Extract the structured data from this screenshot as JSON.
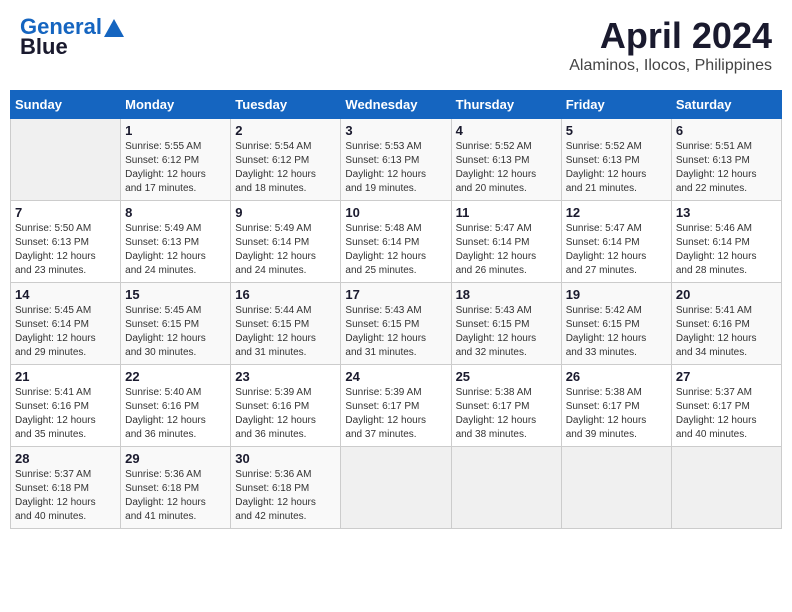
{
  "header": {
    "logo_line1": "General",
    "logo_line2": "Blue",
    "title": "April 2024",
    "subtitle": "Alaminos, Ilocos, Philippines"
  },
  "columns": [
    "Sunday",
    "Monday",
    "Tuesday",
    "Wednesday",
    "Thursday",
    "Friday",
    "Saturday"
  ],
  "weeks": [
    {
      "days": [
        {
          "num": "",
          "detail": ""
        },
        {
          "num": "1",
          "detail": "Sunrise: 5:55 AM\nSunset: 6:12 PM\nDaylight: 12 hours\nand 17 minutes."
        },
        {
          "num": "2",
          "detail": "Sunrise: 5:54 AM\nSunset: 6:12 PM\nDaylight: 12 hours\nand 18 minutes."
        },
        {
          "num": "3",
          "detail": "Sunrise: 5:53 AM\nSunset: 6:13 PM\nDaylight: 12 hours\nand 19 minutes."
        },
        {
          "num": "4",
          "detail": "Sunrise: 5:52 AM\nSunset: 6:13 PM\nDaylight: 12 hours\nand 20 minutes."
        },
        {
          "num": "5",
          "detail": "Sunrise: 5:52 AM\nSunset: 6:13 PM\nDaylight: 12 hours\nand 21 minutes."
        },
        {
          "num": "6",
          "detail": "Sunrise: 5:51 AM\nSunset: 6:13 PM\nDaylight: 12 hours\nand 22 minutes."
        }
      ]
    },
    {
      "days": [
        {
          "num": "7",
          "detail": "Sunrise: 5:50 AM\nSunset: 6:13 PM\nDaylight: 12 hours\nand 23 minutes."
        },
        {
          "num": "8",
          "detail": "Sunrise: 5:49 AM\nSunset: 6:13 PM\nDaylight: 12 hours\nand 24 minutes."
        },
        {
          "num": "9",
          "detail": "Sunrise: 5:49 AM\nSunset: 6:14 PM\nDaylight: 12 hours\nand 24 minutes."
        },
        {
          "num": "10",
          "detail": "Sunrise: 5:48 AM\nSunset: 6:14 PM\nDaylight: 12 hours\nand 25 minutes."
        },
        {
          "num": "11",
          "detail": "Sunrise: 5:47 AM\nSunset: 6:14 PM\nDaylight: 12 hours\nand 26 minutes."
        },
        {
          "num": "12",
          "detail": "Sunrise: 5:47 AM\nSunset: 6:14 PM\nDaylight: 12 hours\nand 27 minutes."
        },
        {
          "num": "13",
          "detail": "Sunrise: 5:46 AM\nSunset: 6:14 PM\nDaylight: 12 hours\nand 28 minutes."
        }
      ]
    },
    {
      "days": [
        {
          "num": "14",
          "detail": "Sunrise: 5:45 AM\nSunset: 6:14 PM\nDaylight: 12 hours\nand 29 minutes."
        },
        {
          "num": "15",
          "detail": "Sunrise: 5:45 AM\nSunset: 6:15 PM\nDaylight: 12 hours\nand 30 minutes."
        },
        {
          "num": "16",
          "detail": "Sunrise: 5:44 AM\nSunset: 6:15 PM\nDaylight: 12 hours\nand 31 minutes."
        },
        {
          "num": "17",
          "detail": "Sunrise: 5:43 AM\nSunset: 6:15 PM\nDaylight: 12 hours\nand 31 minutes."
        },
        {
          "num": "18",
          "detail": "Sunrise: 5:43 AM\nSunset: 6:15 PM\nDaylight: 12 hours\nand 32 minutes."
        },
        {
          "num": "19",
          "detail": "Sunrise: 5:42 AM\nSunset: 6:15 PM\nDaylight: 12 hours\nand 33 minutes."
        },
        {
          "num": "20",
          "detail": "Sunrise: 5:41 AM\nSunset: 6:16 PM\nDaylight: 12 hours\nand 34 minutes."
        }
      ]
    },
    {
      "days": [
        {
          "num": "21",
          "detail": "Sunrise: 5:41 AM\nSunset: 6:16 PM\nDaylight: 12 hours\nand 35 minutes."
        },
        {
          "num": "22",
          "detail": "Sunrise: 5:40 AM\nSunset: 6:16 PM\nDaylight: 12 hours\nand 36 minutes."
        },
        {
          "num": "23",
          "detail": "Sunrise: 5:39 AM\nSunset: 6:16 PM\nDaylight: 12 hours\nand 36 minutes."
        },
        {
          "num": "24",
          "detail": "Sunrise: 5:39 AM\nSunset: 6:17 PM\nDaylight: 12 hours\nand 37 minutes."
        },
        {
          "num": "25",
          "detail": "Sunrise: 5:38 AM\nSunset: 6:17 PM\nDaylight: 12 hours\nand 38 minutes."
        },
        {
          "num": "26",
          "detail": "Sunrise: 5:38 AM\nSunset: 6:17 PM\nDaylight: 12 hours\nand 39 minutes."
        },
        {
          "num": "27",
          "detail": "Sunrise: 5:37 AM\nSunset: 6:17 PM\nDaylight: 12 hours\nand 40 minutes."
        }
      ]
    },
    {
      "days": [
        {
          "num": "28",
          "detail": "Sunrise: 5:37 AM\nSunset: 6:18 PM\nDaylight: 12 hours\nand 40 minutes."
        },
        {
          "num": "29",
          "detail": "Sunrise: 5:36 AM\nSunset: 6:18 PM\nDaylight: 12 hours\nand 41 minutes."
        },
        {
          "num": "30",
          "detail": "Sunrise: 5:36 AM\nSunset: 6:18 PM\nDaylight: 12 hours\nand 42 minutes."
        },
        {
          "num": "",
          "detail": ""
        },
        {
          "num": "",
          "detail": ""
        },
        {
          "num": "",
          "detail": ""
        },
        {
          "num": "",
          "detail": ""
        }
      ]
    }
  ]
}
